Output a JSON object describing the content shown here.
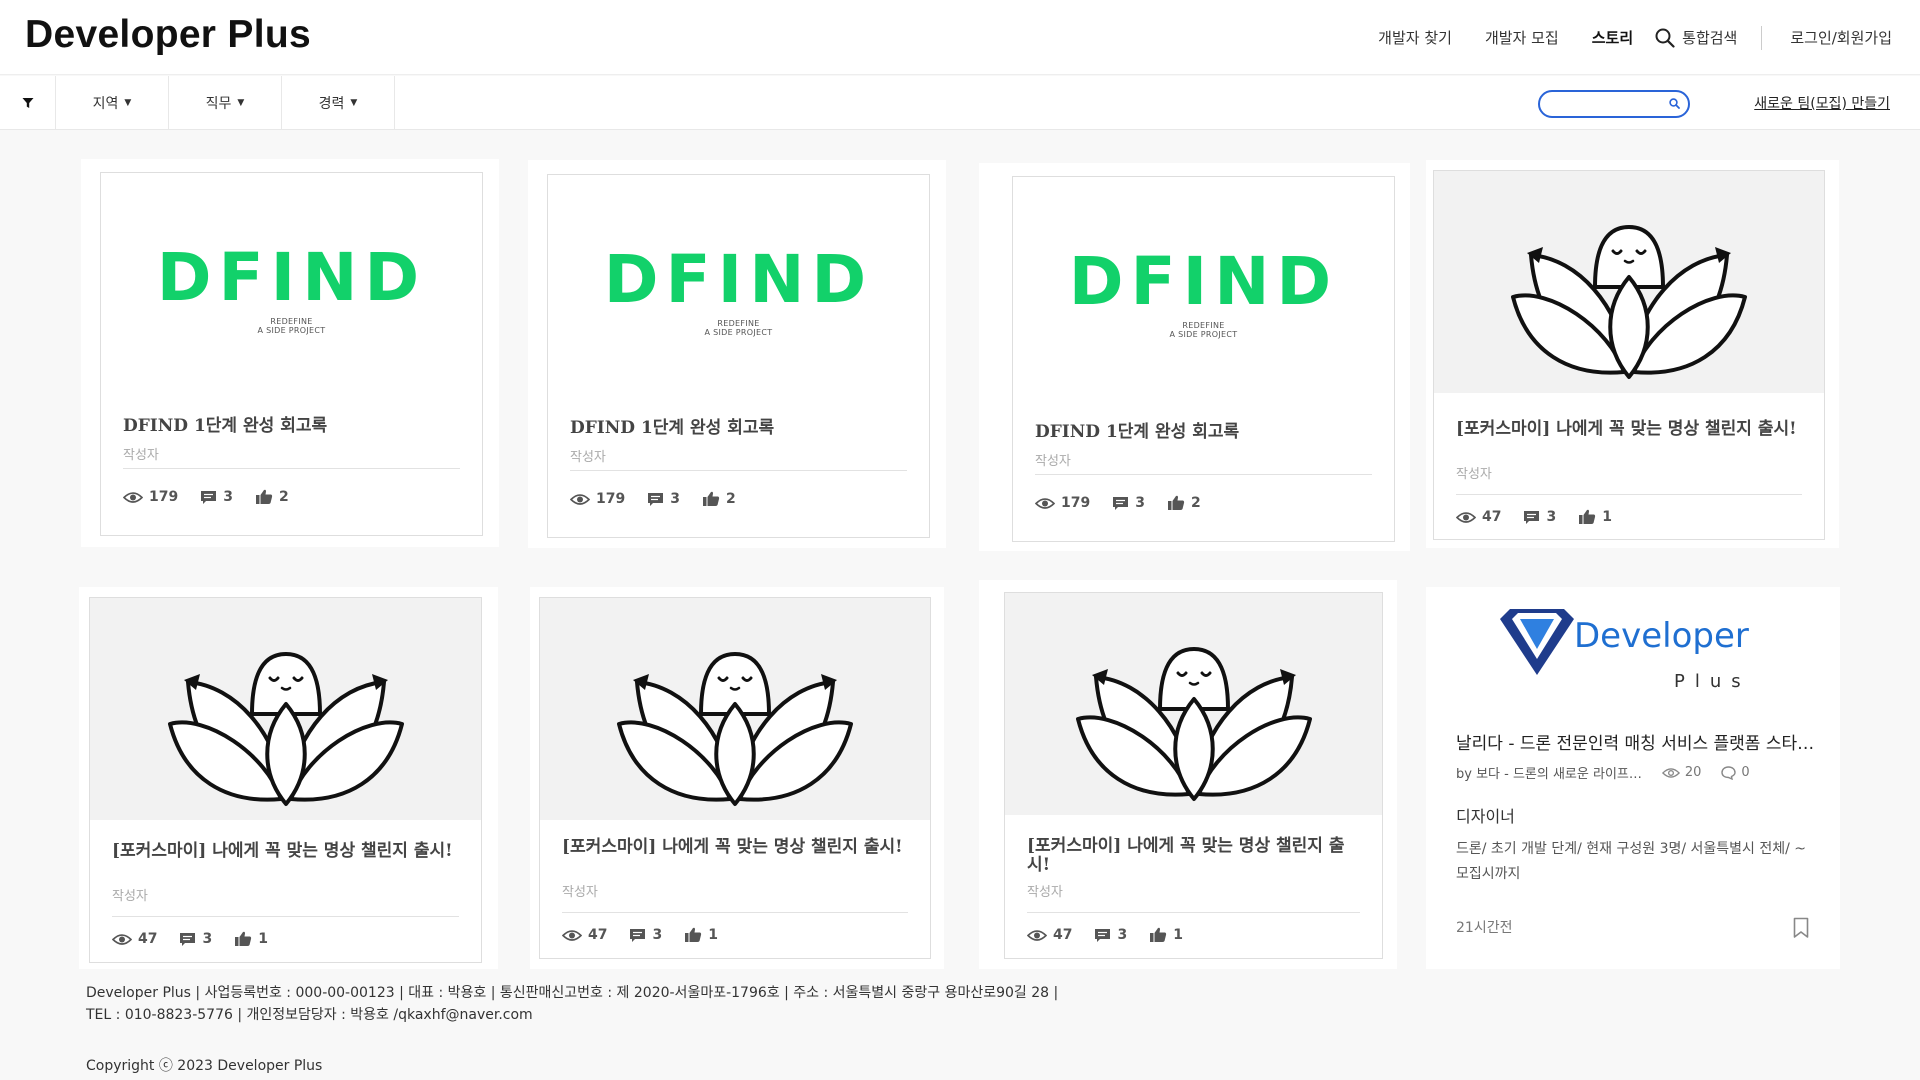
{
  "header": {
    "logo": "Developer Plus",
    "nav": {
      "find_dev": "개발자 찾기",
      "recruit_dev": "개발자 모집",
      "story": "스토리",
      "search": "통합검색",
      "login": "로그인/회원가입"
    }
  },
  "filters": {
    "region": "지역",
    "job": "직무",
    "career": "경력",
    "search_value": "",
    "new_team": "새로운 팀(모집) 만들기"
  },
  "dfind_logo": {
    "wordmark": "DFIND",
    "line1": "REDEFINE",
    "line2": "A SIDE PROJECT"
  },
  "cards": [
    {
      "title": "DFIND 1단계 완성 회고록",
      "author": "작성자",
      "views": "179",
      "comments": "3",
      "likes": "2",
      "image": "dfind"
    },
    {
      "title": "DFIND 1단계 완성 회고록",
      "author": "작성자",
      "views": "179",
      "comments": "3",
      "likes": "2",
      "image": "dfind"
    },
    {
      "title": "DFIND 1단계 완성 회고록",
      "author": "작성자",
      "views": "179",
      "comments": "3",
      "likes": "2",
      "image": "dfind"
    },
    {
      "title": "[포커스마이] 나에게 꼭 맞는 명상 챌린지 출시!",
      "author": "작성자",
      "views": "47",
      "comments": "3",
      "likes": "1",
      "image": "lotus"
    },
    {
      "title": "[포커스마이] 나에게 꼭 맞는 명상 챌린지 출시!",
      "author": "작성자",
      "views": "47",
      "comments": "3",
      "likes": "1",
      "image": "lotus"
    },
    {
      "title": "[포커스마이] 나에게 꼭 맞는 명상 챌린지 출시!",
      "author": "작성자",
      "views": "47",
      "comments": "3",
      "likes": "1",
      "image": "lotus"
    },
    {
      "title": "[포커스마이] 나에게 꼭 맞는 명상 챌린지 출시!",
      "author": "작성자",
      "views": "47",
      "comments": "3",
      "likes": "1",
      "image": "lotus"
    }
  ],
  "recruit_card": {
    "logo_word": "Developer",
    "logo_plus": "Plus",
    "title": "날리다 - 드론 전문인력 매칭 서비스 플랫폼 스타…",
    "by": "by 보다 - 드론의 새로운 라이프…",
    "views": "20",
    "comments": "0",
    "role": "디자이너",
    "desc": "드론/ 초기 개발 단계/ 현재 구성원 3명/ 서울특별시 전체/ ~모집시까지",
    "time": "21시간전"
  },
  "footer": {
    "line1": "Developer Plus | 사업등록번호 : 000-00-00123 | 대표 : 박용호 | 통신판매신고번호 : 제 2020-서울마포-1796호 | 주소 : 서울특별시 중랑구 용마산로90길 28 |",
    "line2": "TEL : 010-8823-5776 | 개인정보담당자 : 박용호 /qkaxhf@naver.com",
    "copyright": "Copyright ⓒ 2023 Developer Plus"
  },
  "colors": {
    "dfind_green": "#12d16a",
    "search_border": "#2a64d8",
    "brand_blue": "#1f6fd1"
  }
}
